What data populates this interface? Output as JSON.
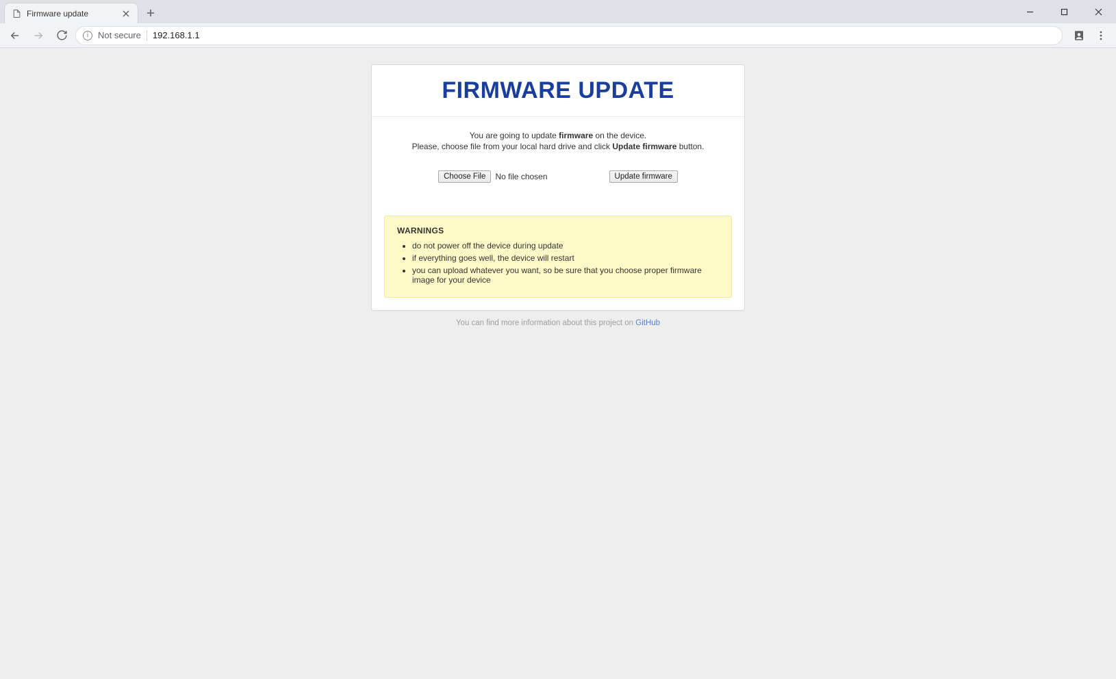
{
  "browser": {
    "tab_title": "Firmware update",
    "security_label": "Not secure",
    "url": "192.168.1.1"
  },
  "page": {
    "heading": "FIRMWARE UPDATE",
    "intro": {
      "line1_pre": "You are going to update ",
      "line1_bold": "firmware",
      "line1_post": " on the device.",
      "line2_pre": "Please, choose file from your local hard drive and click ",
      "line2_bold": "Update firmware",
      "line2_post": " button."
    },
    "choose_file_label": "Choose File",
    "no_file_label": "No file chosen",
    "update_button_label": "Update firmware",
    "warnings_heading": "WARNINGS",
    "warnings": [
      "do not power off the device during update",
      "if everything goes well, the device will restart",
      "you can upload whatever you want, so be sure that you choose proper firmware image for your device"
    ],
    "footer_pre": "You can find more information about this project on ",
    "footer_link": "GitHub"
  }
}
